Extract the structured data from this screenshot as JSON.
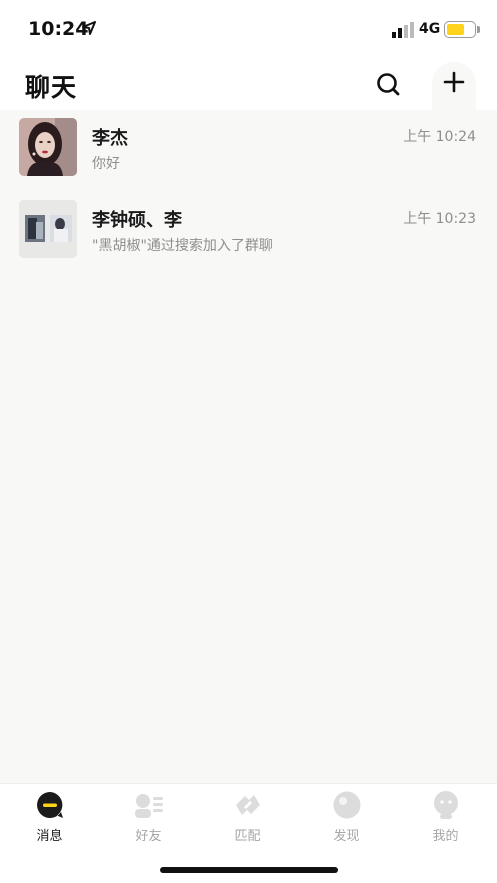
{
  "status_bar": {
    "time": "10:24",
    "network": "4G",
    "battery_level": 0.65,
    "battery_color": "#ffd21c"
  },
  "header": {
    "title": "聊天",
    "search_icon": "search-icon",
    "add_icon": "plus-icon"
  },
  "chats": [
    {
      "name": "李杰",
      "last_message": "你好",
      "time": "上午 10:24",
      "avatar": "portrait-photo"
    },
    {
      "name": "李钟硕、李",
      "last_message": "\"黑胡椒\"通过搜索加入了群聊",
      "time": "上午 10:23",
      "avatar": "group-collage"
    }
  ],
  "tabbar": {
    "active_color": "#1b1b1b",
    "accent": "#ffd21c",
    "tabs": [
      {
        "label": "消息",
        "icon": "message-bubble-icon",
        "active": true
      },
      {
        "label": "好友",
        "icon": "friends-card-icon",
        "active": false
      },
      {
        "label": "匹配",
        "icon": "match-link-icon",
        "active": false
      },
      {
        "label": "发现",
        "icon": "discover-sphere-icon",
        "active": false
      },
      {
        "label": "我的",
        "icon": "profile-face-icon",
        "active": false
      }
    ]
  }
}
